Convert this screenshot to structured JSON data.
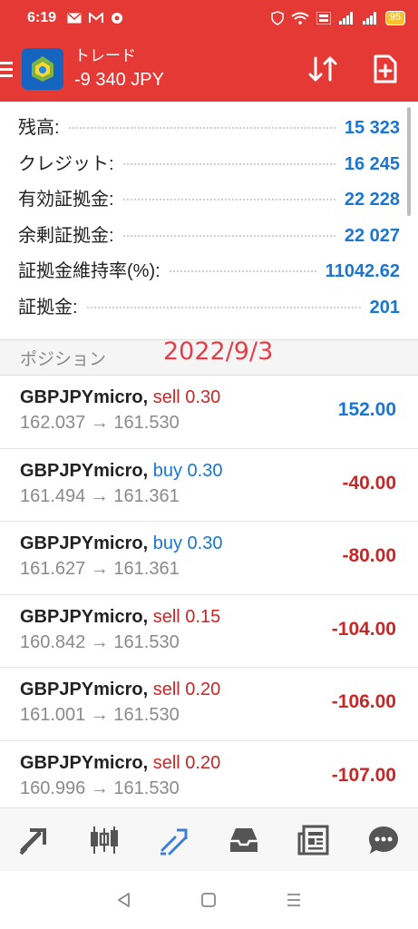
{
  "status_bar": {
    "time": "6:19",
    "battery": "95"
  },
  "header": {
    "title": "トレード",
    "profit": "-9 340 JPY"
  },
  "summary": [
    {
      "label": "残高:",
      "value": "15 323"
    },
    {
      "label": "クレジット:",
      "value": "16 245"
    },
    {
      "label": "有効証拠金:",
      "value": "22 228"
    },
    {
      "label": "余剰証拠金:",
      "value": "22 027"
    },
    {
      "label": "証拠金維持率(%):",
      "value": "11042.62"
    },
    {
      "label": "証拠金:",
      "value": "201"
    }
  ],
  "positions": {
    "title": "ポジション",
    "annotation": "2022/9/3",
    "rows": [
      {
        "symbol": "GBPJPYmicro,",
        "side": "sell 0.30",
        "type": "sell",
        "prices": "162.037 → 161.530",
        "profit": "152.00",
        "sign": "pos"
      },
      {
        "symbol": "GBPJPYmicro,",
        "side": "buy 0.30",
        "type": "buy",
        "prices": "161.494 → 161.361",
        "profit": "-40.00",
        "sign": "neg"
      },
      {
        "symbol": "GBPJPYmicro,",
        "side": "buy 0.30",
        "type": "buy",
        "prices": "161.627 → 161.361",
        "profit": "-80.00",
        "sign": "neg"
      },
      {
        "symbol": "GBPJPYmicro,",
        "side": "sell 0.15",
        "type": "sell",
        "prices": "160.842 → 161.530",
        "profit": "-104.00",
        "sign": "neg"
      },
      {
        "symbol": "GBPJPYmicro,",
        "side": "sell 0.20",
        "type": "sell",
        "prices": "161.001 → 161.530",
        "profit": "-106.00",
        "sign": "neg"
      },
      {
        "symbol": "GBPJPYmicro,",
        "side": "sell 0.20",
        "type": "sell",
        "prices": "160.996 → 161.530",
        "profit": "-107.00",
        "sign": "neg"
      }
    ]
  },
  "bottom_nav": [
    {
      "icon": "quotes-icon",
      "active": false
    },
    {
      "icon": "chart-icon",
      "active": false
    },
    {
      "icon": "trade-icon",
      "active": true
    },
    {
      "icon": "history-icon",
      "active": false
    },
    {
      "icon": "news-icon",
      "active": false
    },
    {
      "icon": "chat-icon",
      "active": false
    }
  ],
  "colors": {
    "accent": "#e53935",
    "positive": "#1976d2",
    "negative": "#c62828"
  }
}
